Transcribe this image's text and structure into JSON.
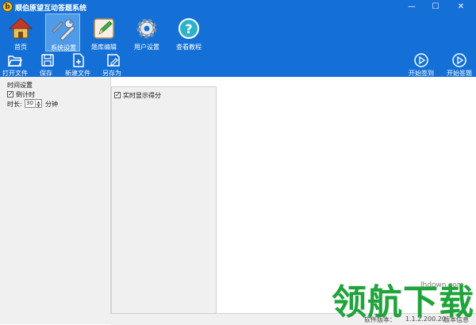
{
  "window": {
    "title": "顺伯原望互动答题系统",
    "minimize_glyph": "—",
    "maximize_glyph": "☐",
    "close_glyph": "✕"
  },
  "nav": {
    "items": [
      {
        "label": "首页",
        "icon": "home-icon"
      },
      {
        "label": "系统设置",
        "icon": "wrench-settings-icon",
        "active": true
      },
      {
        "label": "题库编辑",
        "icon": "edit-pen-icon"
      },
      {
        "label": "用户设置",
        "icon": "gear-icon"
      },
      {
        "label": "查看教程",
        "icon": "help-icon"
      }
    ]
  },
  "toolbar": {
    "open_file": "打开文件",
    "save": "保存",
    "new_file": "新建文件",
    "save_as": "另存为",
    "start_signin": "开始签到",
    "start_answer": "开始答题"
  },
  "settings": {
    "group_title": "时间设置",
    "countdown_label": "倒计时",
    "countdown_checked": true,
    "duration_label": "时长:",
    "duration_value": "30",
    "duration_unit": "分钟",
    "realtime_score_label": "实时显示得分",
    "realtime_score_checked": true
  },
  "statusbar": {
    "version_label": "软件版本：",
    "version_value": "1.1.2.200.20",
    "edition_label": "版本信息"
  },
  "watermark": {
    "site": "lhdown.com",
    "logo": "领航下载"
  },
  "colors": {
    "ribbon": "#1470d6",
    "active_tab": "#4e9be9",
    "watermark_green": "#1fa33a"
  }
}
